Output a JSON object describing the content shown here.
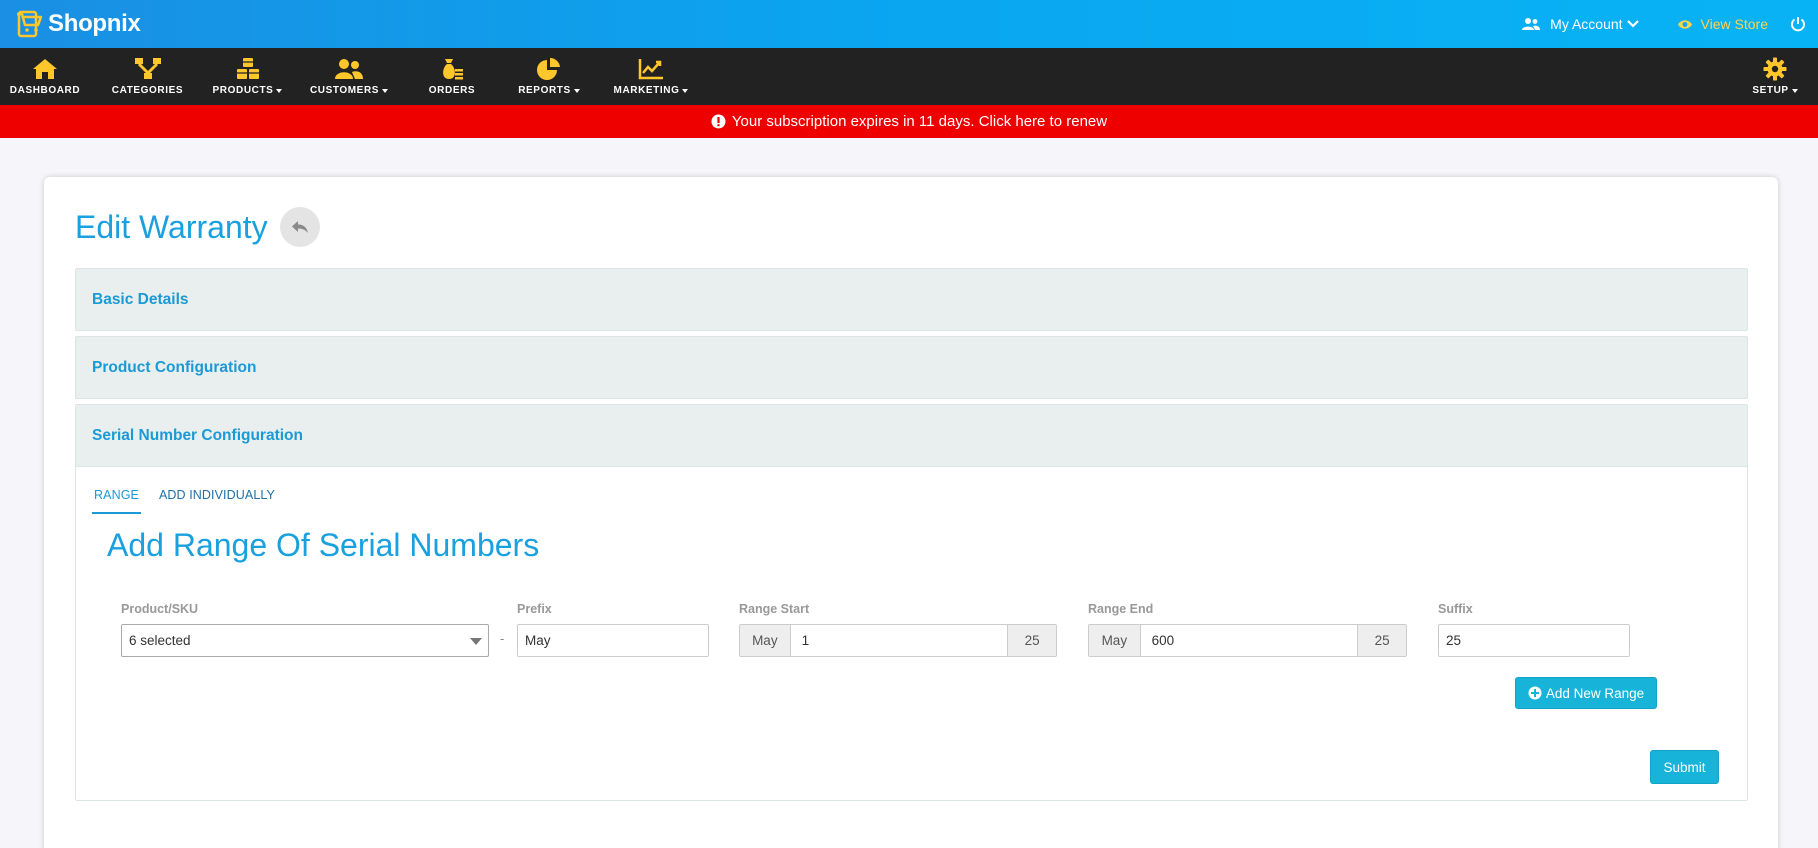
{
  "app": {
    "name": "Shopnix"
  },
  "header": {
    "account_label": "My Account",
    "view_store_label": "View Store"
  },
  "nav": {
    "items": [
      {
        "label": "DASHBOARD",
        "icon": "home-icon",
        "has_dropdown": false
      },
      {
        "label": "CATEGORIES",
        "icon": "sitemap-icon",
        "has_dropdown": false
      },
      {
        "label": "PRODUCTS",
        "icon": "cubes-icon",
        "has_dropdown": true
      },
      {
        "label": "CUSTOMERS",
        "icon": "users-icon",
        "has_dropdown": true
      },
      {
        "label": "ORDERS",
        "icon": "money-bag-icon",
        "has_dropdown": false
      },
      {
        "label": "REPORTS",
        "icon": "pie-chart-icon",
        "has_dropdown": true
      },
      {
        "label": "MARKETING",
        "icon": "line-chart-icon",
        "has_dropdown": true
      }
    ],
    "setup_label": "SETUP"
  },
  "alert": {
    "text": "Your subscription expires in 11 days. Click here to renew"
  },
  "page": {
    "title": "Edit Warranty",
    "sections": {
      "basic": "Basic Details",
      "product": "Product Configuration",
      "serial": "Serial Number Configuration"
    },
    "tabs": [
      "RANGE",
      "ADD INDIVIDUALLY"
    ],
    "range_title": "Add Range Of Serial Numbers",
    "form": {
      "product_sku_label": "Product/SKU",
      "product_sku_value": "6 selected",
      "prefix_label": "Prefix",
      "prefix_value": "May",
      "range_start_label": "Range Start",
      "range_start_prefix": "May",
      "range_start_value": "1",
      "range_start_suffix": "25",
      "range_end_label": "Range End",
      "range_end_prefix": "May",
      "range_end_value": "600",
      "range_end_suffix": "25",
      "suffix_label": "Suffix",
      "suffix_value": "25",
      "separator": "-"
    },
    "add_range_label": "Add New Range",
    "submit_label": "Submit"
  },
  "colors": {
    "accent": "#19a0df",
    "nav_bg": "#222222",
    "alert_bg": "#ee0000",
    "icon_yellow": "#ffc72c",
    "button": "#17b3d9"
  }
}
